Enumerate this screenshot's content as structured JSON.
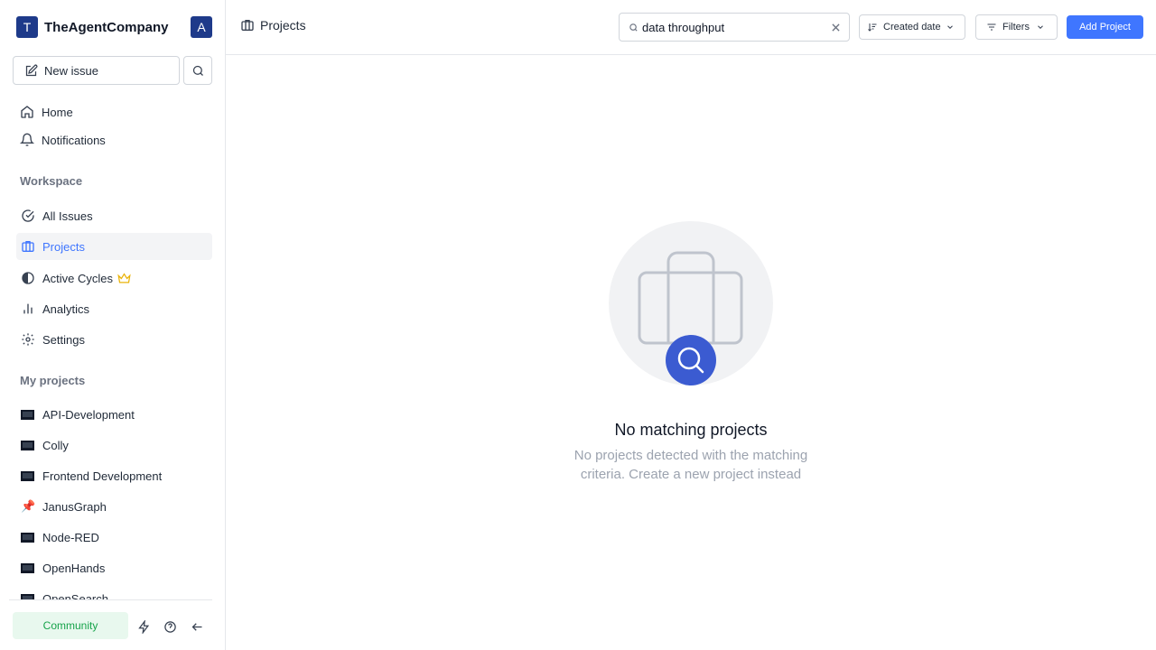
{
  "workspace": {
    "logo_letter": "T",
    "name": "TheAgentCompany",
    "user_initial": "A"
  },
  "sidebar": {
    "new_issue_label": "New issue",
    "nav": [
      {
        "label": "Home",
        "icon": "home-icon"
      },
      {
        "label": "Notifications",
        "icon": "bell-icon"
      }
    ],
    "workspace_label": "Workspace",
    "workspace_items": [
      {
        "label": "All Issues",
        "icon": "check-circle-icon"
      },
      {
        "label": "Projects",
        "icon": "briefcase-icon",
        "active": true
      },
      {
        "label": "Active Cycles",
        "icon": "contrast-icon",
        "badge": "crown-icon"
      },
      {
        "label": "Analytics",
        "icon": "bar-chart-icon"
      },
      {
        "label": "Settings",
        "icon": "gear-icon"
      }
    ],
    "my_projects_label": "My projects",
    "projects": [
      {
        "label": "API-Development",
        "emoji": "laptop"
      },
      {
        "label": "Colly",
        "emoji": "laptop"
      },
      {
        "label": "Frontend Development",
        "emoji": "laptop"
      },
      {
        "label": "JanusGraph",
        "emoji": "📌"
      },
      {
        "label": "Node-RED",
        "emoji": "laptop"
      },
      {
        "label": "OpenHands",
        "emoji": "laptop"
      },
      {
        "label": "OpenSearch",
        "emoji": "laptop"
      }
    ],
    "footer": {
      "community_label": "Community"
    }
  },
  "header": {
    "title": "Projects",
    "search_value": "data throughput",
    "sort_label": "Created date",
    "filters_label": "Filters",
    "add_project_label": "Add Project"
  },
  "empty_state": {
    "title": "No matching projects",
    "description": "No projects detected with the matching criteria. Create a new project instead"
  },
  "colors": {
    "accent": "#3f76ff",
    "workspace_logo": "#1e3a8a",
    "community_bg": "#e8f8ee",
    "community_text": "#16a34a"
  }
}
